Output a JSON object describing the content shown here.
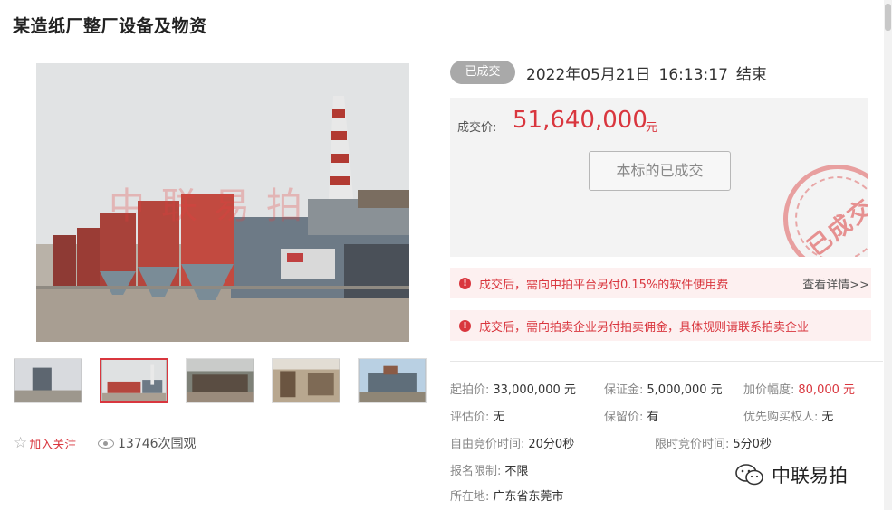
{
  "page_title": "某造纸厂整厂设备及物资",
  "gallery": {
    "watermark": "中联易拍",
    "thumbnails": [
      "thumb-1",
      "thumb-2",
      "thumb-3",
      "thumb-4",
      "thumb-5"
    ],
    "active_index": 1
  },
  "actions": {
    "follow_label": "加入关注",
    "views_label": "13746次围观"
  },
  "status": {
    "badge": "已成交",
    "end_date": "2022年05月21日",
    "end_time": "16:13:17",
    "end_suffix": "结束"
  },
  "price": {
    "label": "成交价:",
    "value": "51,640,000",
    "unit": "元",
    "button": "本标的已成交",
    "stamp": "已成交"
  },
  "notices": [
    {
      "text": "成交后，需向中拍平台另付0.15%的软件使用费",
      "link": "查看详情>>"
    },
    {
      "text": "成交后，需向拍卖企业另付拍卖佣金，具体规则请联系拍卖企业"
    }
  ],
  "details": {
    "start_price_label": "起拍价:",
    "start_price": "33,000,000 元",
    "deposit_label": "保证金:",
    "deposit": "5,000,000 元",
    "increment_label": "加价幅度:",
    "increment": "80,000 元",
    "appraisal_label": "评估价:",
    "appraisal": "无",
    "reserve_label": "保留价:",
    "reserve": "有",
    "priority_label": "优先购买权人:",
    "priority": "无",
    "free_time_label": "自由竞价时间:",
    "free_time": "20分0秒",
    "limited_time_label": "限时竞价时间:",
    "limited_time": "5分0秒",
    "registration_label": "报名限制:",
    "registration": "不限",
    "location_label": "所在地:",
    "location": "广东省东莞市"
  },
  "brand": {
    "name": "中联易拍"
  },
  "colors": {
    "accent": "#d9363e",
    "badge_gray": "#a9a9a9"
  }
}
